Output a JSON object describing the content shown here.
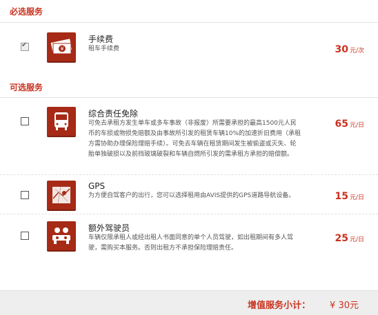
{
  "required_section": {
    "title": "必选服务",
    "items": [
      {
        "name": "手续费",
        "desc": "租车手续费",
        "price": "30",
        "unit": "元/次",
        "checked": true,
        "icon": "money-icon"
      }
    ]
  },
  "optional_section": {
    "title": "可选服务",
    "items": [
      {
        "name": "综合责任免除",
        "desc": "可免去承租方发生单车或多车事故（非报废）所需要承担的最高1500元人民币的车损或物损免赔额及由事故所引发的租赁车辆10%的加速折旧费用（承租方需协助办理保险理赔手续）。可免去车辆在租赁期间发生被偷盗或灭失、轮胎单独破损以及前挡玻璃破裂和车辆自燃所引发的需承租方承担的赔偿额。",
        "price": "65",
        "unit": "元/日",
        "checked": false,
        "icon": "bus-icon"
      },
      {
        "name": "GPS",
        "desc": "为方便自驾客户的出行，您可以选择租用由AVIS提供的GPS道路导航设备。",
        "price": "15",
        "unit": "元/日",
        "checked": false,
        "icon": "map-icon"
      },
      {
        "name": "额外驾驶员",
        "desc": "车辆仅限承租人或经出租人书面同意的单个人员驾驶，如出租期间有多人驾驶，需购买本服务。否则出租方不承担保险理赔责任。",
        "price": "25",
        "unit": "元/日",
        "checked": false,
        "icon": "drivers-icon"
      }
    ]
  },
  "footer": {
    "label": "增值服务小计：",
    "amount": "¥ 30元"
  },
  "colors": {
    "accent": "#c9321f",
    "icon_bg": "#a62a16"
  }
}
